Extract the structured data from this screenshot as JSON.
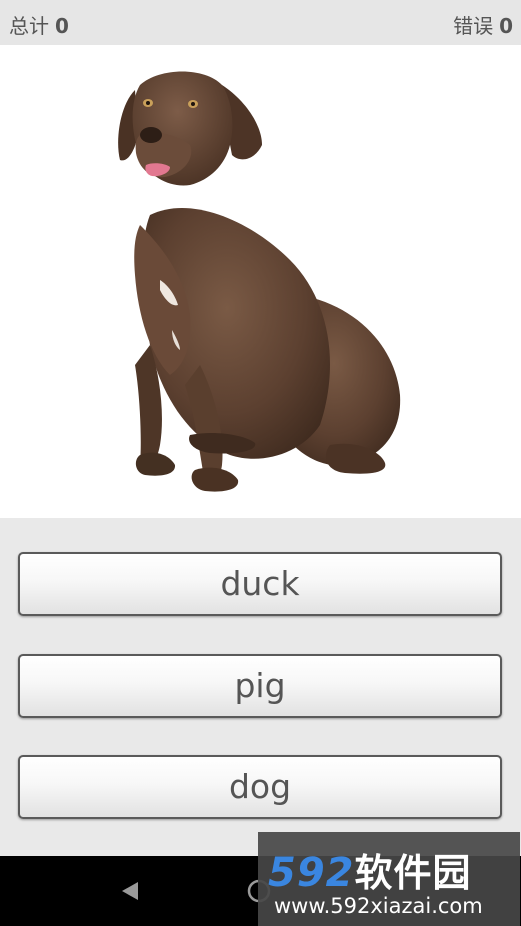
{
  "score": {
    "total_label": "总计",
    "total_value": "0",
    "errors_label": "错误",
    "errors_value": "0"
  },
  "picture": {
    "subject": "dog"
  },
  "answers": [
    {
      "label": "duck"
    },
    {
      "label": "pig"
    },
    {
      "label": "dog"
    }
  ],
  "watermark": {
    "logo_number": "592",
    "logo_text": "软件园",
    "url": "www.592xiazai.com"
  },
  "colors": {
    "header_bg": "#e6e6e6",
    "picture_bg": "#ffffff",
    "app_bg": "#e9e9e9",
    "button_text": "#555555",
    "nav_bar_bg": "#000000",
    "watermark_accent": "#3a86e0"
  }
}
